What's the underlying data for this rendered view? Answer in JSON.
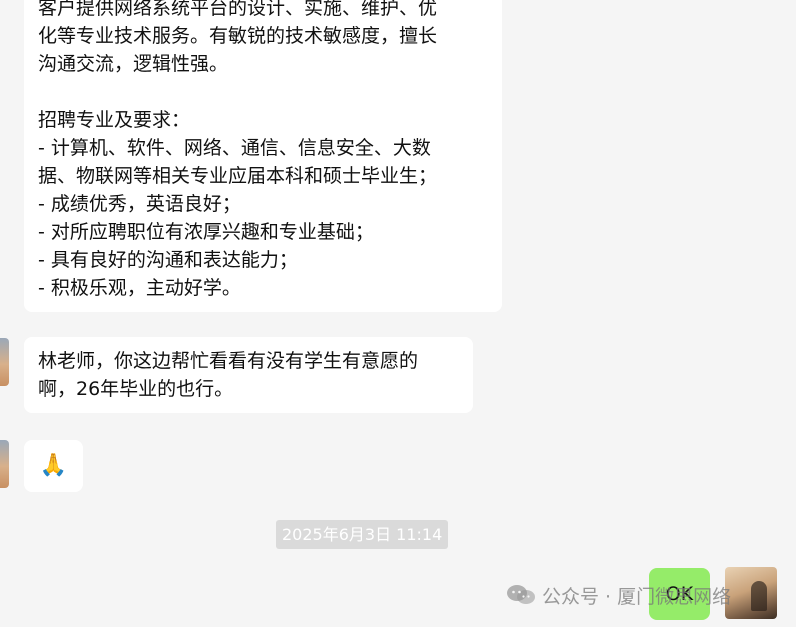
{
  "messages": {
    "long_message": {
      "lines_top": [
        "客户提供网络系统平台的设计、实施、维护、优",
        "化等专业技术服务。有敏锐的技术敏感度，擅长",
        "沟通交流，逻辑性强。"
      ],
      "lines_bottom": [
        "招聘专业及要求：",
        "- 计算机、软件、网络、通信、信息安全、大数",
        "据、物联网等相关专业应届本科和硕士毕业生；",
        "- 成绩优秀，英语良好；",
        "- 对所应聘职位有浓厚兴趣和专业基础；",
        "- 具有良好的沟通和表达能力；",
        "- 积极乐观，主动好学。"
      ]
    },
    "ask_message": {
      "lines": [
        "林老师，你这边帮忙看看有没有学生有意愿的",
        "啊，26年毕业的也行。"
      ]
    },
    "emoji_message": {
      "text": "🙏"
    },
    "timestamp": "2025年6月3日 11:14",
    "ok_message": {
      "text": "OK"
    }
  },
  "watermark": {
    "text": "公众号 · 厦门微思网络",
    "icon": "wechat-official-account-icon"
  },
  "colors": {
    "background": "#f5f5f5",
    "incoming_bubble": "#ffffff",
    "outgoing_bubble": "#95ec69",
    "timestamp_bg": "#dadada"
  }
}
